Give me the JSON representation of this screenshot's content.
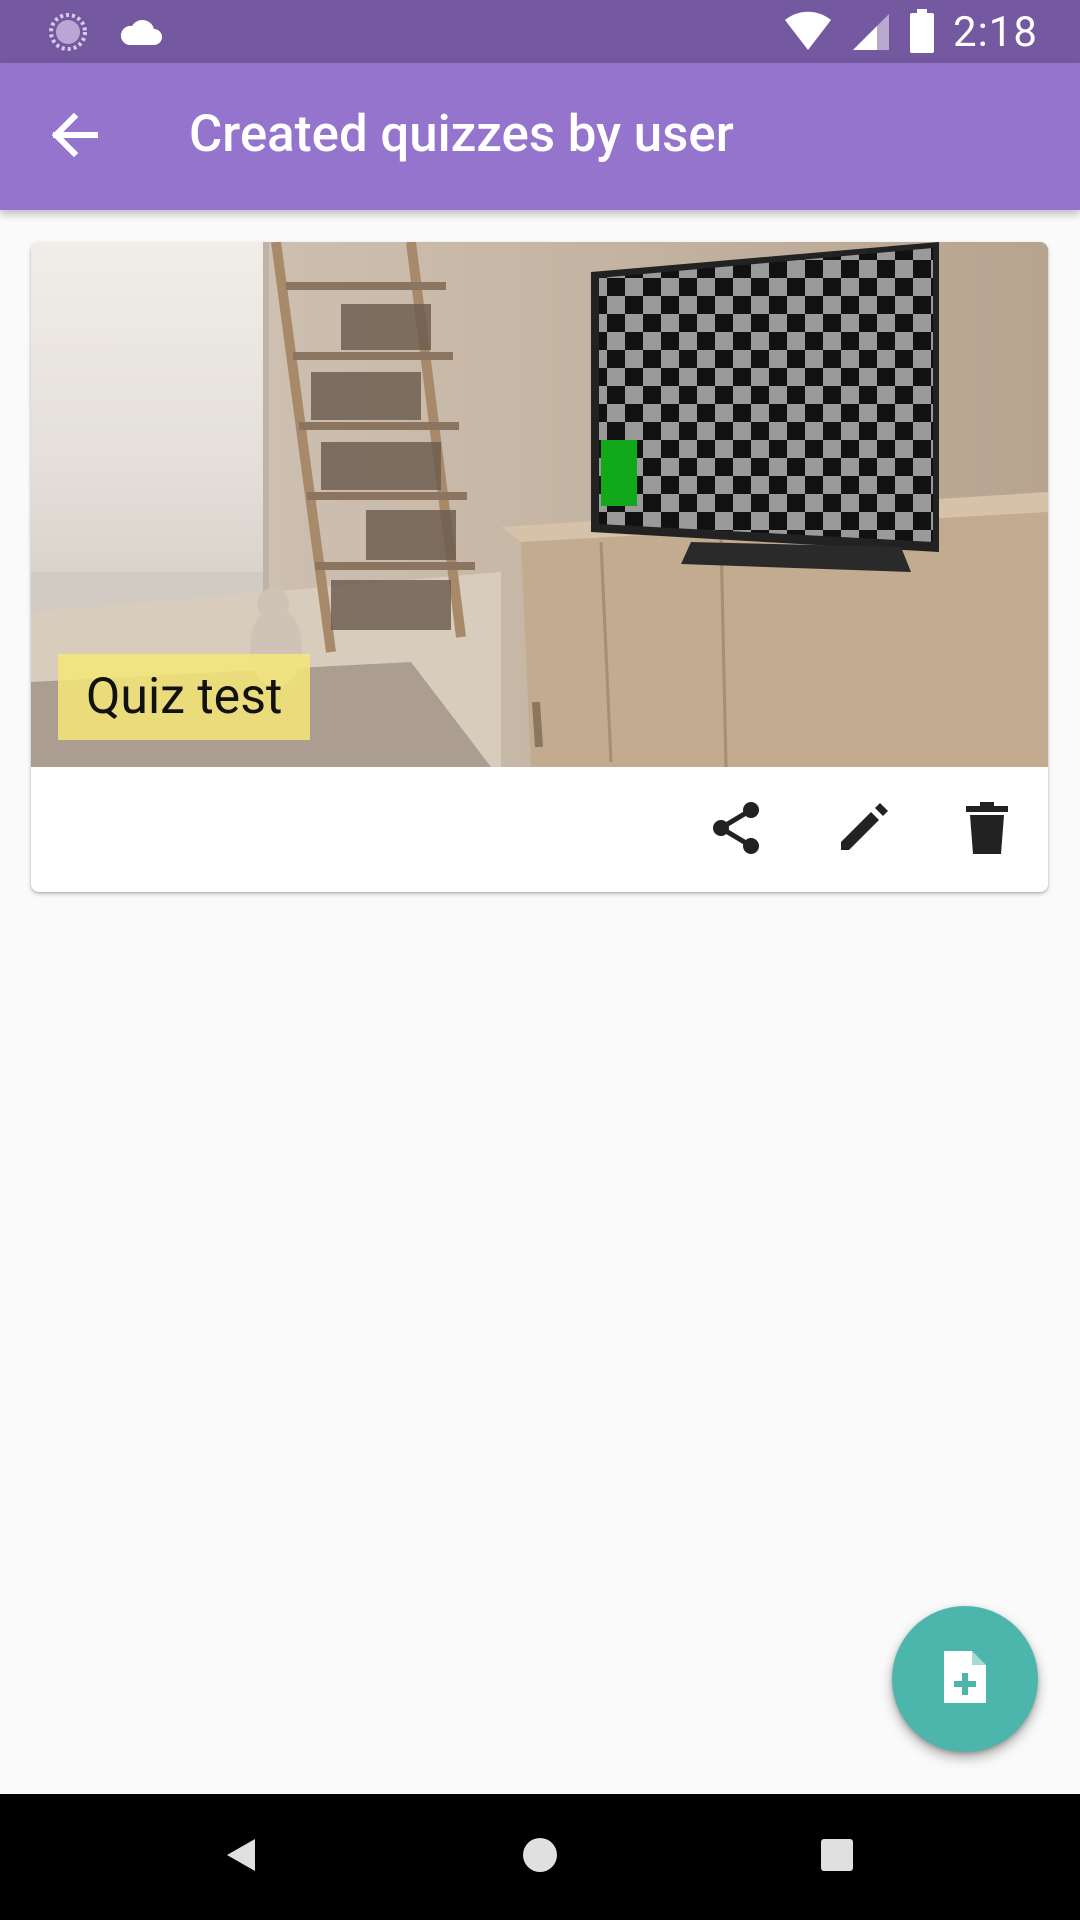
{
  "status_bar": {
    "time": "2:18",
    "left_icons": [
      "sync-icon",
      "cloud-icon"
    ],
    "right_icons": [
      "wifi-icon",
      "cellular-signal-icon",
      "battery-icon"
    ]
  },
  "app_bar": {
    "title": "Created quizzes by user",
    "back_icon": "arrow-back-icon",
    "background": "#9474cd"
  },
  "quizzes": [
    {
      "title": "Quiz test",
      "image": "room-with-tv-checkerboard",
      "actions": [
        "share-icon",
        "edit-icon",
        "delete-icon"
      ]
    }
  ],
  "fab": {
    "icon": "add-file-icon",
    "color": "#4db6ac"
  },
  "nav_bar": {
    "buttons": [
      "back-triangle-icon",
      "home-circle-icon",
      "recents-square-icon"
    ]
  },
  "colors": {
    "status_bar": "#7559a0",
    "app_bar": "#9474cd",
    "background": "#fafafa",
    "chip": "#f4e778",
    "fab": "#4db6ac"
  }
}
